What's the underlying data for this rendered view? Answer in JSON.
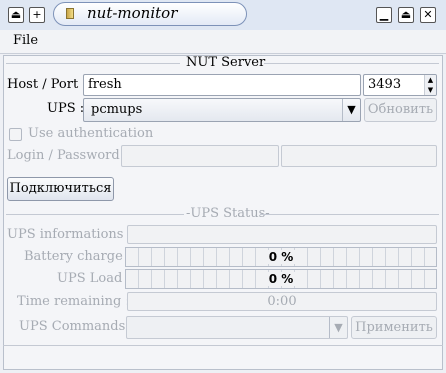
{
  "window": {
    "title": "nut-monitor",
    "buttons": {
      "left_a": "⏏",
      "left_b": "+",
      "minimize": "▁",
      "maximize": "⏏",
      "close": "✕"
    }
  },
  "menu": {
    "file": "File"
  },
  "nut_server": {
    "group_title": "NUT Server",
    "host_port_label": "Host / Port :",
    "host": "fresh",
    "port": "3493",
    "ups_label": "UPS :",
    "ups_selected": "pcmups",
    "refresh_button": "Обновить",
    "use_auth_label": "Use authentication",
    "use_auth_checked": false,
    "login_password_label": "Login / Password :",
    "login": "",
    "password": "",
    "connect_button": "Подключиться"
  },
  "ups_status": {
    "group_title": "UPS Status",
    "informations_label": "UPS informations :",
    "informations_value": "",
    "battery_label": "Battery charge :",
    "battery_text": "0 %",
    "battery_fraction": 0,
    "load_label": "UPS Load :",
    "load_text": "0 %",
    "load_fraction": 0,
    "time_label": "Time remaining :",
    "time_value": "0:00",
    "commands_label": "UPS Commands :",
    "commands_selected": "",
    "apply_button": "Применить"
  },
  "icons": {
    "app": "battery-icon",
    "combo_arrow": "chevron-down-icon",
    "spin": "spin-arrows-icon"
  }
}
